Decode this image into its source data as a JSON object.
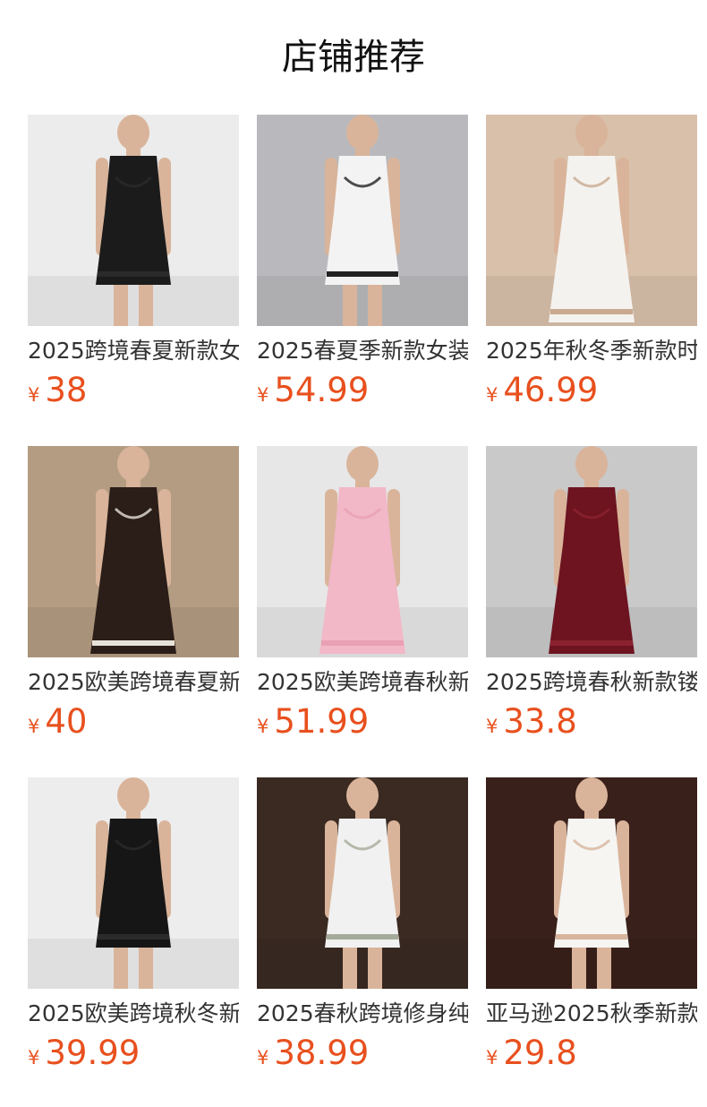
{
  "section": {
    "title": "店铺推荐"
  },
  "currency_symbol": "¥",
  "products": [
    {
      "name": "2025跨境春夏新款女",
      "price": "38",
      "image": "black-sleeveless-ruffle-mini-dress",
      "bg": "#ececec",
      "dress": "#1b1b1b",
      "accent": "#2a2a2a"
    },
    {
      "name": "2025春夏季新款女装",
      "price": "54.99",
      "image": "white-bow-print-mini-dress",
      "bg": "#b9b9bd",
      "dress": "#f3f3f3",
      "accent": "#222222"
    },
    {
      "name": "2025年秋冬季新款时",
      "price": "46.99",
      "image": "white-ruched-deep-v-dress",
      "bg": "#d8c0aa",
      "dress": "#f4f2ee",
      "accent": "#c9a98f"
    },
    {
      "name": "2025欧美跨境春夏新",
      "price": "40",
      "image": "brown-polka-dot-maxi-dress",
      "bg": "#b49c82",
      "dress": "#2b1d18",
      "accent": "#e7e2d8"
    },
    {
      "name": "2025欧美跨境春秋新",
      "price": "51.99",
      "image": "pink-off-shoulder-gown",
      "bg": "#e7e7e7",
      "dress": "#f2b8c8",
      "accent": "#e9a0b4"
    },
    {
      "name": "2025跨境春秋新款镂",
      "price": "33.8",
      "image": "burgundy-long-sleeve-cutout-dress",
      "bg": "#c9c9c9",
      "dress": "#6d1420",
      "accent": "#8c2230"
    },
    {
      "name": "2025欧美跨境秋冬新",
      "price": "39.99",
      "image": "black-hoodie-mini-dress",
      "bg": "#ededed",
      "dress": "#161616",
      "accent": "#2b2b2b"
    },
    {
      "name": "2025春秋跨境修身纯",
      "price": "38.99",
      "image": "white-long-sleeve-skater-dress",
      "bg": "#3a2a22",
      "dress": "#f1f1f1",
      "accent": "#a5ab9a"
    },
    {
      "name": "亚马逊2025秋季新款",
      "price": "29.8",
      "image": "white-off-shoulder-mini-dress",
      "bg": "#3a201a",
      "dress": "#f6f5f2",
      "accent": "#d7b59c"
    }
  ]
}
